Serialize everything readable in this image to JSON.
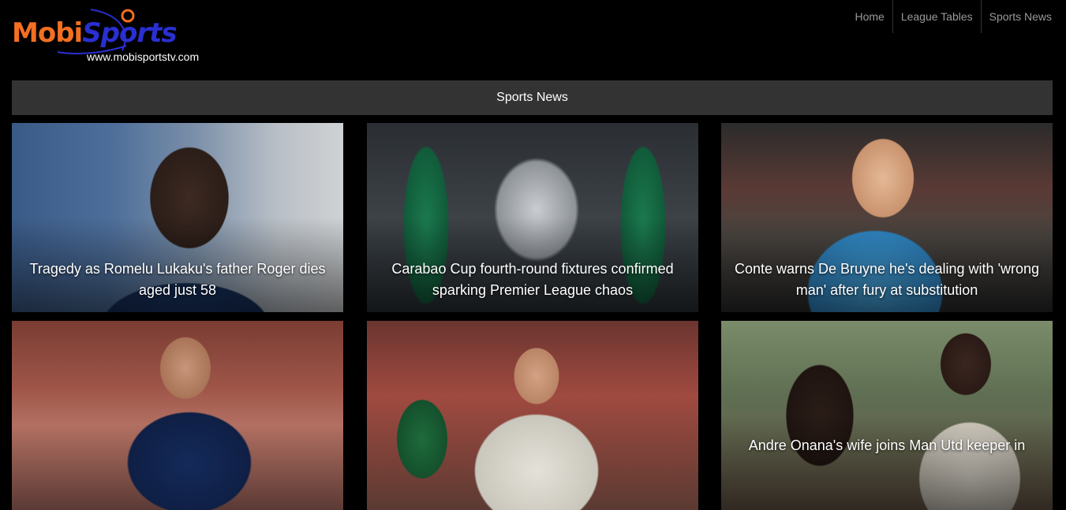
{
  "brand": {
    "name_part1": "Mobi",
    "name_part2": "Sports",
    "url": "www.mobisportstv.com",
    "colors": {
      "orange": "#f36f21",
      "blue": "#2a2fd1"
    }
  },
  "nav": {
    "items": [
      {
        "label": "Home"
      },
      {
        "label": "League Tables"
      },
      {
        "label": "Sports News"
      }
    ]
  },
  "section": {
    "title": "Sports News"
  },
  "articles": [
    {
      "title": "Tragedy as Romelu Lukaku's father Roger dies aged just 58",
      "image": "lukaku-photo"
    },
    {
      "title": "Carabao Cup fourth-round fixtures confirmed sparking Premier League chaos",
      "image": "carabao-cup-trophy-photo"
    },
    {
      "title": "Conte warns De Bruyne he's dealing with 'wrong man' after fury at substitution",
      "image": "de-bruyne-photo"
    },
    {
      "title": "",
      "image": "nuno-espirito-santo-photo"
    },
    {
      "title": "",
      "image": "harry-kane-photo"
    },
    {
      "title": "Andre Onana's wife joins Man Utd keeper in",
      "image": "onana-couple-photo"
    }
  ]
}
